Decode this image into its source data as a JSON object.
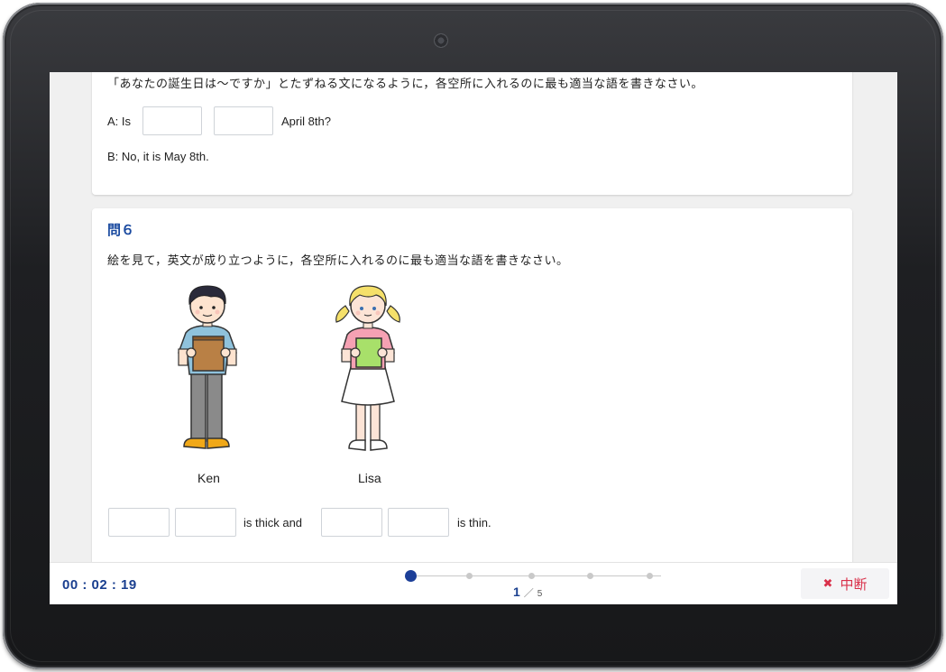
{
  "question5": {
    "instruction": "「あなたの誕生日は～ですか」とたずねる文になるように，各空所に入れるのに最も適当な語を書きなさい。",
    "line_a_prefix": "A: Is",
    "line_a_suffix": "April 8th?",
    "line_b": "B: No, it is May 8th."
  },
  "question6": {
    "title": "問６",
    "instruction": "絵を見て，英文が成り立つように，各空所に入れるのに最も適当な語を書きなさい。",
    "person1": "Ken",
    "person2": "Lisa",
    "mid_text": "is thick and",
    "end_text": "is thin."
  },
  "footer": {
    "timer": "00 : 02 : 19",
    "current_page": "1",
    "page_separator": "／",
    "total_pages": "5",
    "steps_total": 5,
    "steps_current": 1,
    "quit_icon": "close-icon",
    "quit_label": "中断"
  },
  "colors": {
    "accent": "#1c3f98",
    "danger": "#d9304a"
  }
}
